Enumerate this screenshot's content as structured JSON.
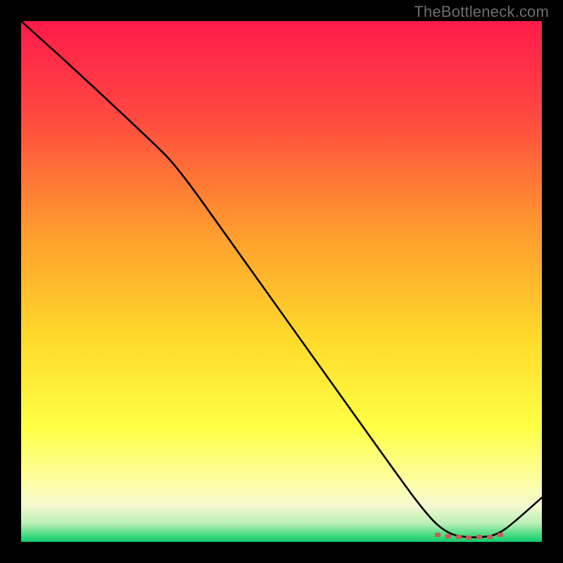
{
  "watermark": "TheBottleneck.com",
  "chart_data": {
    "type": "line",
    "title": "",
    "xlabel": "",
    "ylabel": "",
    "xlim": [
      0,
      100
    ],
    "ylim": [
      0,
      100
    ],
    "grid": false,
    "series": [
      {
        "name": "bottleneck-curve",
        "x": [
          0,
          10,
          25,
          30,
          40,
          50,
          60,
          70,
          78,
          82,
          86,
          90,
          92,
          94,
          100
        ],
        "values": [
          100,
          91,
          77,
          72,
          58,
          44,
          30,
          16,
          5,
          1.5,
          0.8,
          1.0,
          1.8,
          3.2,
          8.5
        ]
      }
    ],
    "markers": {
      "name": "optimal-range",
      "x": [
        80,
        82,
        84,
        86,
        88,
        90,
        92
      ],
      "y": [
        1.4,
        1.1,
        0.9,
        0.8,
        0.9,
        1.0,
        1.4
      ],
      "color": "#c85a5a"
    },
    "gradient_stops": [
      {
        "offset": 0.0,
        "color": "#ff1a4a"
      },
      {
        "offset": 0.18,
        "color": "#ff4840"
      },
      {
        "offset": 0.4,
        "color": "#ff9a2e"
      },
      {
        "offset": 0.6,
        "color": "#ffd82a"
      },
      {
        "offset": 0.78,
        "color": "#ffff44"
      },
      {
        "offset": 0.88,
        "color": "#fefea0"
      },
      {
        "offset": 0.93,
        "color": "#f5f9d0"
      },
      {
        "offset": 0.965,
        "color": "#b8efb4"
      },
      {
        "offset": 0.99,
        "color": "#36d87a"
      },
      {
        "offset": 1.0,
        "color": "#12c96e"
      }
    ]
  }
}
